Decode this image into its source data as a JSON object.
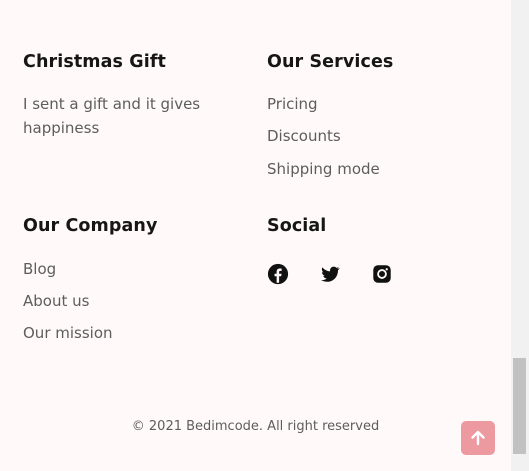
{
  "footer": {
    "gift": {
      "title": "Christmas Gift",
      "text": "I sent a gift and it gives happiness"
    },
    "services": {
      "title": "Our Services",
      "links": [
        "Pricing",
        "Discounts",
        "Shipping mode"
      ]
    },
    "company": {
      "title": "Our Company",
      "links": [
        "Blog",
        "About us",
        "Our mission"
      ]
    },
    "social": {
      "title": "Social",
      "icons": [
        "facebook-icon",
        "twitter-icon",
        "instagram-icon"
      ]
    },
    "copyright": "© 2021 Bedimcode. All right reserved"
  },
  "scroll_top": {
    "icon": "arrow-up-icon",
    "color": "#ec9aa0"
  }
}
